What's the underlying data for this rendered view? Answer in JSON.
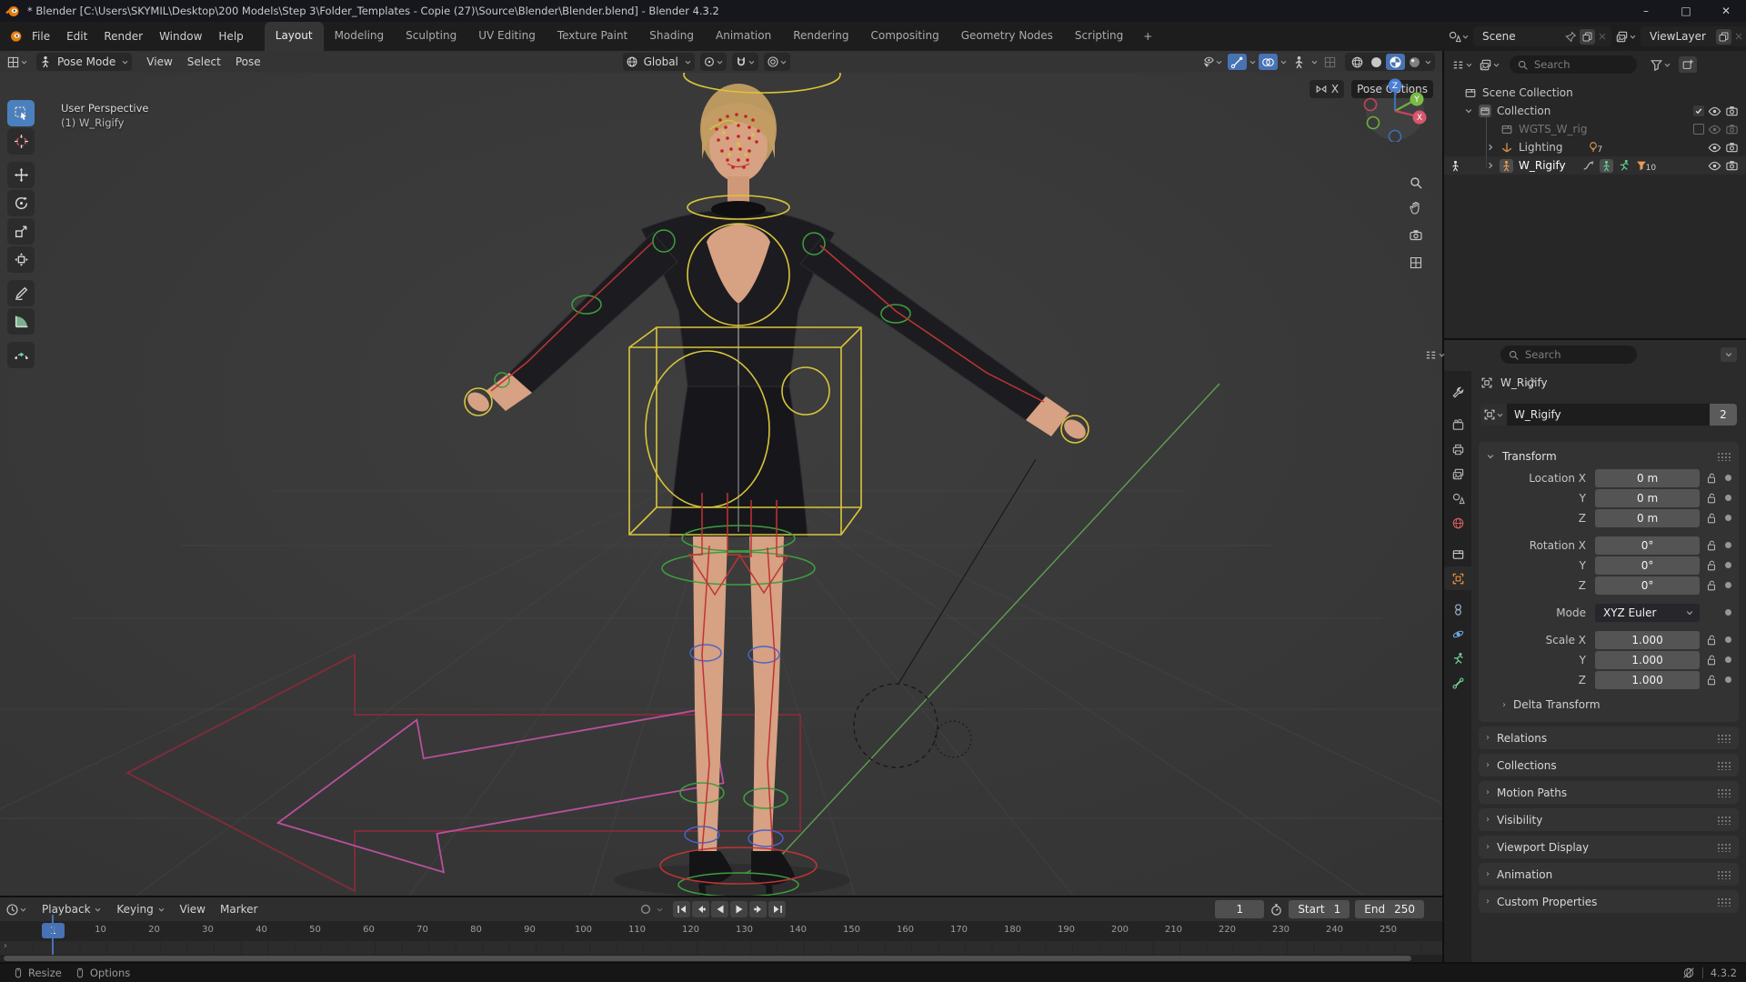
{
  "window": {
    "title": "* Blender [C:\\Users\\SKYMIL\\Desktop\\200 Models\\Step 3\\Folder_Templates - Copie (27)\\Source\\Blender\\Blender.blend] - Blender 4.3.2",
    "minimize": "–",
    "maximize": "□",
    "close": "✕"
  },
  "topbar": {
    "menus": [
      "File",
      "Edit",
      "Render",
      "Window",
      "Help"
    ],
    "tabs": [
      {
        "label": "Layout",
        "kind": "active"
      },
      {
        "label": "Modeling"
      },
      {
        "label": "Sculpting"
      },
      {
        "label": "UV Editing"
      },
      {
        "label": "Texture Paint"
      },
      {
        "label": "Shading"
      },
      {
        "label": "Animation"
      },
      {
        "label": "Rendering"
      },
      {
        "label": "Compositing"
      },
      {
        "label": "Geometry Nodes"
      },
      {
        "label": "Scripting"
      }
    ],
    "new_tab": "+",
    "scene_name": "Scene",
    "view_layer_name": "ViewLayer"
  },
  "viewport": {
    "mode": "Pose Mode",
    "menus": [
      "View",
      "Select",
      "Pose"
    ],
    "orientation": "Global",
    "overlay_line1": "User Perspective",
    "overlay_line2": "(1) W_Rigify",
    "mirror_x_label": "X",
    "pose_options_label": "Pose Options",
    "gizmo_axes": {
      "x": "X",
      "y": "Y",
      "z": "Z"
    },
    "shading_modes": [
      "wireframe",
      "solid",
      "material-preview",
      "rendered"
    ],
    "active_shading": "material-preview"
  },
  "toolbar": {
    "tools": [
      "select-box",
      "cursor",
      "move",
      "rotate",
      "scale",
      "transform",
      "annotate",
      "measure",
      "pose-breakdowner"
    ],
    "active_tool": "select-box"
  },
  "outliner": {
    "search_placeholder": "Search",
    "rows": [
      {
        "label": "Scene Collection"
      },
      {
        "label": "Collection"
      },
      {
        "label": "WGTS_W_rig"
      },
      {
        "label": "Lighting",
        "count": "7"
      },
      {
        "label": "W_Rigify",
        "count": "10"
      }
    ]
  },
  "properties": {
    "search_placeholder": "Search",
    "breadcrumb": "W_Rigify",
    "name_value": "W_Rigify",
    "users_count": "2",
    "transform_title": "Transform",
    "transform_rows": [
      {
        "label": "Location X",
        "value": "0 m"
      },
      {
        "label": "Y",
        "value": "0 m"
      },
      {
        "label": "Z",
        "value": "0 m"
      },
      {
        "label": "Rotation X",
        "value": "0°",
        "gap": true
      },
      {
        "label": "Y",
        "value": "0°"
      },
      {
        "label": "Z",
        "value": "0°"
      },
      {
        "label": "Mode",
        "value": "XYZ Euler",
        "kind": "dropdown",
        "gap": true
      },
      {
        "label": "Scale X",
        "value": "1.000",
        "gap": true
      },
      {
        "label": "Y",
        "value": "1.000"
      },
      {
        "label": "Z",
        "value": "1.000"
      }
    ],
    "subpanel": "Delta Transform",
    "collapsed_panels": [
      "Relations",
      "Collections",
      "Motion Paths",
      "Visibility",
      "Viewport Display",
      "Animation",
      "Custom Properties"
    ]
  },
  "timeline": {
    "menus": [
      "Playback",
      "Keying",
      "View",
      "Marker"
    ],
    "current_frame": "1",
    "frame_field_value": "1",
    "start_label": "Start",
    "start_value": "1",
    "end_label": "End",
    "end_value": "250",
    "ruler": [
      "10",
      "20",
      "30",
      "40",
      "50",
      "60",
      "70",
      "80",
      "90",
      "100",
      "110",
      "120",
      "130",
      "140",
      "150",
      "160",
      "170",
      "180",
      "190",
      "200",
      "210",
      "220",
      "230",
      "240",
      "250"
    ]
  },
  "statusbar": {
    "resize_label": "Resize",
    "options_label": "Options",
    "version": "4.3.2"
  },
  "colors": {
    "accent": "#4772b3",
    "active_tool": "#4b80bf",
    "object_orange": "#e58c3c",
    "control_yellow": "#d9c53a"
  }
}
